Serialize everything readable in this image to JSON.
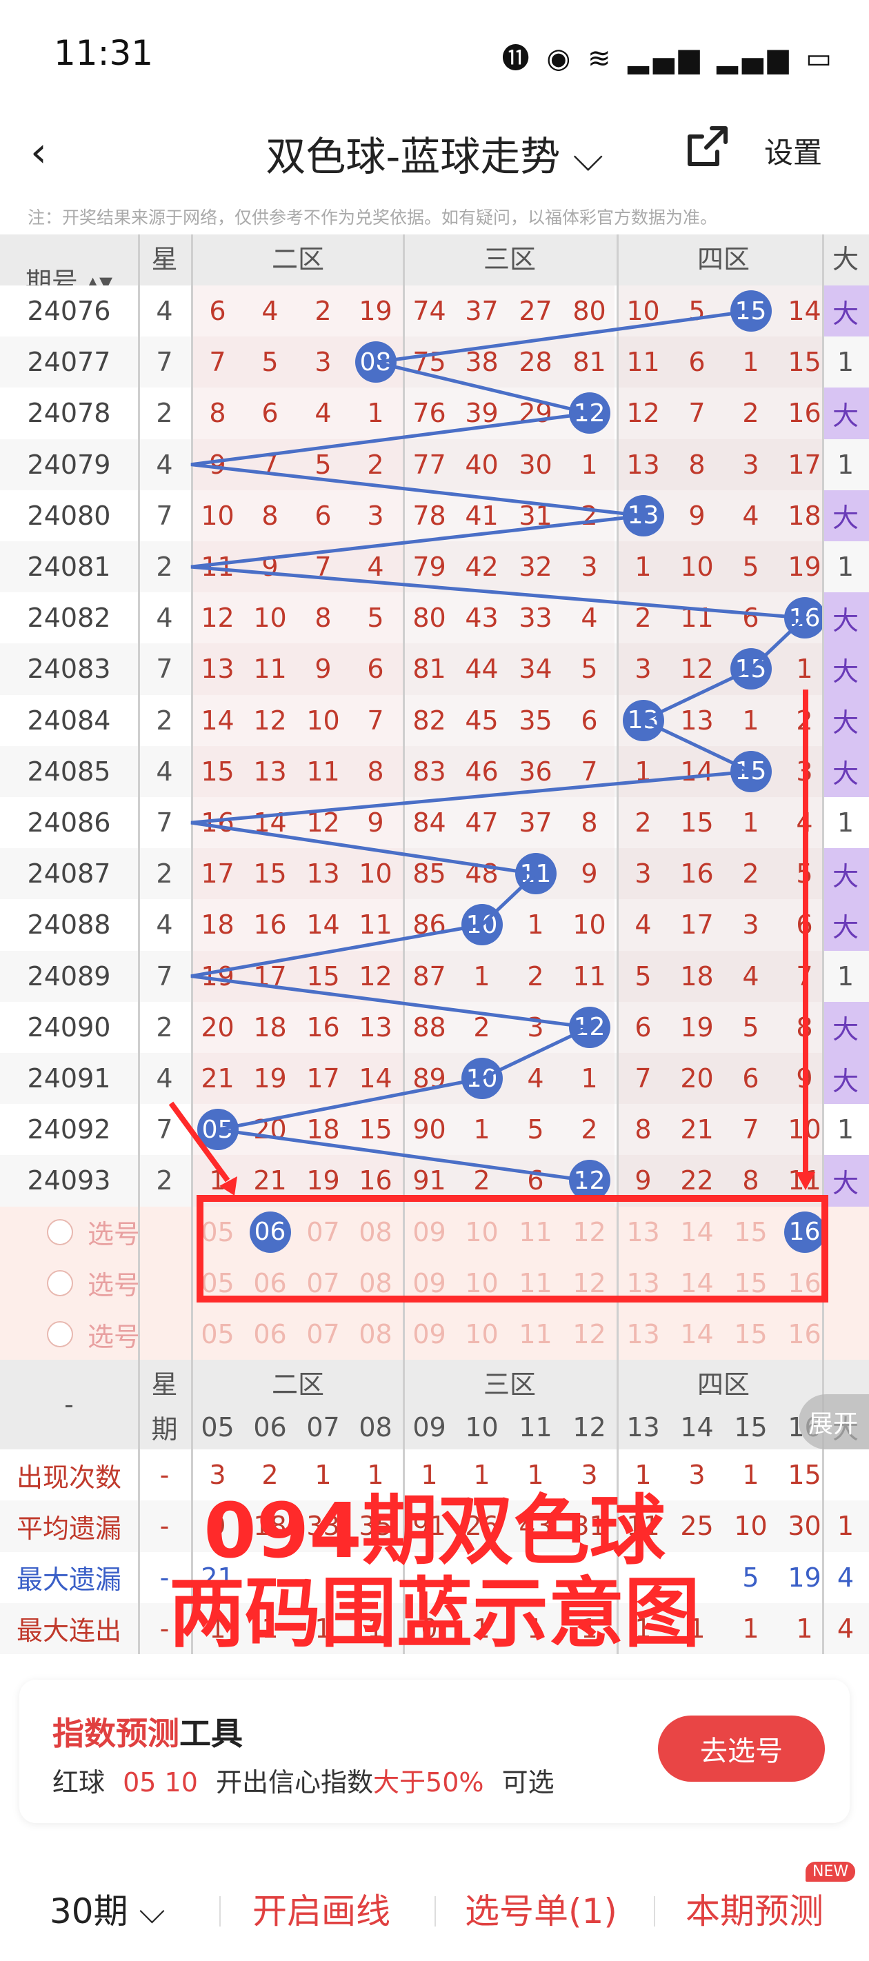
{
  "status": {
    "time": "11:31",
    "icons": "⓫ ◉ ≋ ▂▄▆ ▂▄▆ ▭"
  },
  "nav": {
    "back": "‹",
    "title": "双色球-蓝球走势 ⌵",
    "settings": "设置"
  },
  "notice": "注：开奖结果来源于网络，仅供参考不作为兑奖依据。如有疑问，以福体彩官方数据为准。",
  "header": {
    "period": "期号",
    "week1": "星",
    "week2": "期",
    "zones": [
      "二区",
      "三区",
      "四区",
      "大"
    ],
    "cols": [
      "05",
      "06",
      "07",
      "08",
      "09",
      "10",
      "11",
      "12",
      "13",
      "14",
      "15",
      "16",
      "大"
    ]
  },
  "rows": [
    {
      "p": "24076",
      "w": "4",
      "v": [
        "6",
        "4",
        "2",
        "19",
        "74",
        "37",
        "27",
        "80",
        "10",
        "5",
        "15",
        "14",
        "大"
      ],
      "hit": 10
    },
    {
      "p": "24077",
      "w": "7",
      "v": [
        "7",
        "5",
        "3",
        "08",
        "75",
        "38",
        "28",
        "81",
        "11",
        "6",
        "1",
        "15",
        "1"
      ],
      "hit": 3
    },
    {
      "p": "24078",
      "w": "2",
      "v": [
        "8",
        "6",
        "4",
        "1",
        "76",
        "39",
        "29",
        "12",
        "12",
        "7",
        "2",
        "16",
        "大"
      ],
      "hit": 7
    },
    {
      "p": "24079",
      "w": "4",
      "v": [
        "9",
        "7",
        "5",
        "2",
        "77",
        "40",
        "30",
        "1",
        "13",
        "8",
        "3",
        "17",
        "1"
      ],
      "hit": -1
    },
    {
      "p": "24080",
      "w": "7",
      "v": [
        "10",
        "8",
        "6",
        "3",
        "78",
        "41",
        "31",
        "2",
        "13",
        "9",
        "4",
        "18",
        "大"
      ],
      "hit": 8
    },
    {
      "p": "24081",
      "w": "2",
      "v": [
        "11",
        "9",
        "7",
        "4",
        "79",
        "42",
        "32",
        "3",
        "1",
        "10",
        "5",
        "19",
        "1"
      ],
      "hit": -1
    },
    {
      "p": "24082",
      "w": "4",
      "v": [
        "12",
        "10",
        "8",
        "5",
        "80",
        "43",
        "33",
        "4",
        "2",
        "11",
        "6",
        "16",
        "大"
      ],
      "hit": 11
    },
    {
      "p": "24083",
      "w": "7",
      "v": [
        "13",
        "11",
        "9",
        "6",
        "81",
        "44",
        "34",
        "5",
        "3",
        "12",
        "15",
        "1",
        "大"
      ],
      "hit": 10
    },
    {
      "p": "24084",
      "w": "2",
      "v": [
        "14",
        "12",
        "10",
        "7",
        "82",
        "45",
        "35",
        "6",
        "13",
        "13",
        "1",
        "2",
        "大"
      ],
      "hit": 8
    },
    {
      "p": "24085",
      "w": "4",
      "v": [
        "15",
        "13",
        "11",
        "8",
        "83",
        "46",
        "36",
        "7",
        "1",
        "14",
        "15",
        "3",
        "大"
      ],
      "hit": 10
    },
    {
      "p": "24086",
      "w": "7",
      "v": [
        "16",
        "14",
        "12",
        "9",
        "84",
        "47",
        "37",
        "8",
        "2",
        "15",
        "1",
        "4",
        "1"
      ],
      "hit": -1
    },
    {
      "p": "24087",
      "w": "2",
      "v": [
        "17",
        "15",
        "13",
        "10",
        "85",
        "48",
        "11",
        "9",
        "3",
        "16",
        "2",
        "5",
        "大"
      ],
      "hit": 6
    },
    {
      "p": "24088",
      "w": "4",
      "v": [
        "18",
        "16",
        "14",
        "11",
        "86",
        "10",
        "1",
        "10",
        "4",
        "17",
        "3",
        "6",
        "大"
      ],
      "hit": 5
    },
    {
      "p": "24089",
      "w": "7",
      "v": [
        "19",
        "17",
        "15",
        "12",
        "87",
        "1",
        "2",
        "11",
        "5",
        "18",
        "4",
        "7",
        "1"
      ],
      "hit": -1
    },
    {
      "p": "24090",
      "w": "2",
      "v": [
        "20",
        "18",
        "16",
        "13",
        "88",
        "2",
        "3",
        "12",
        "6",
        "19",
        "5",
        "8",
        "大"
      ],
      "hit": 7
    },
    {
      "p": "24091",
      "w": "4",
      "v": [
        "21",
        "19",
        "17",
        "14",
        "89",
        "10",
        "4",
        "1",
        "7",
        "20",
        "6",
        "9",
        "大"
      ],
      "hit": 5
    },
    {
      "p": "24092",
      "w": "7",
      "v": [
        "05",
        "20",
        "18",
        "15",
        "90",
        "1",
        "5",
        "2",
        "8",
        "21",
        "7",
        "10",
        "1"
      ],
      "hit": 0
    },
    {
      "p": "24093",
      "w": "2",
      "v": [
        "1",
        "21",
        "19",
        "16",
        "91",
        "2",
        "6",
        "12",
        "9",
        "22",
        "8",
        "11",
        "大"
      ],
      "hit": 7
    }
  ],
  "select_rows": [
    {
      "label": "选号",
      "v": [
        "05",
        "06",
        "07",
        "08",
        "09",
        "10",
        "11",
        "12",
        "13",
        "14",
        "15",
        "16"
      ],
      "picked": [
        1,
        11
      ]
    },
    {
      "label": "选号",
      "v": [
        "05",
        "06",
        "07",
        "08",
        "09",
        "10",
        "11",
        "12",
        "13",
        "14",
        "15",
        "16"
      ],
      "picked": []
    },
    {
      "label": "选号",
      "v": [
        "05",
        "06",
        "07",
        "08",
        "09",
        "10",
        "11",
        "12",
        "13",
        "14",
        "15",
        "16"
      ],
      "picked": []
    }
  ],
  "stats_header": {
    "dash": "-",
    "week1": "星",
    "week2": "期",
    "zones": [
      "二区",
      "三区",
      "四区"
    ],
    "cols": [
      "05",
      "06",
      "07",
      "08",
      "09",
      "10",
      "11",
      "12",
      "13",
      "14",
      "15",
      "16",
      "大"
    ]
  },
  "stats": [
    {
      "label": "出现次数",
      "color": "#c0392b",
      "v": [
        "-",
        "3",
        "2",
        "1",
        "1",
        "1",
        "1",
        "1",
        "3",
        "1",
        "3",
        "1",
        "15"
      ]
    },
    {
      "label": "平均遗漏",
      "color": "#c0392b",
      "v": [
        "-",
        "9",
        "18",
        "33",
        "35",
        "91",
        "26",
        "43",
        "31",
        "11",
        "25",
        "10",
        "30",
        "1"
      ]
    },
    {
      "label": "最大遗漏",
      "color": "#3a5fc7",
      "v": [
        "-",
        "21",
        "",
        "",
        "",
        "",
        "",
        "",
        "",
        "",
        "",
        "5",
        "19",
        "4"
      ]
    },
    {
      "label": "最大连出",
      "color": "#c0392b",
      "v": [
        "-",
        "1",
        "1",
        "1",
        "1",
        "0",
        "1",
        "1",
        "1",
        "1",
        "1",
        "1",
        "1",
        "4"
      ]
    }
  ],
  "expand": "展开",
  "overlay": {
    "line1": "094期双色球",
    "line2": "两码围蓝示意图"
  },
  "tool": {
    "title_red": "指数预测",
    "title_black": "工具",
    "sub_a": "红球",
    "sub_nums": "05 10",
    "sub_b": "开出信心指数",
    "sub_c": "大于50%",
    "sub_d": "可选",
    "button": "去选号"
  },
  "footer": {
    "periods": "30期 ⌵",
    "draw": "开启画线",
    "list": "选号单(1)",
    "predict": "本期预测",
    "badge": "NEW"
  }
}
